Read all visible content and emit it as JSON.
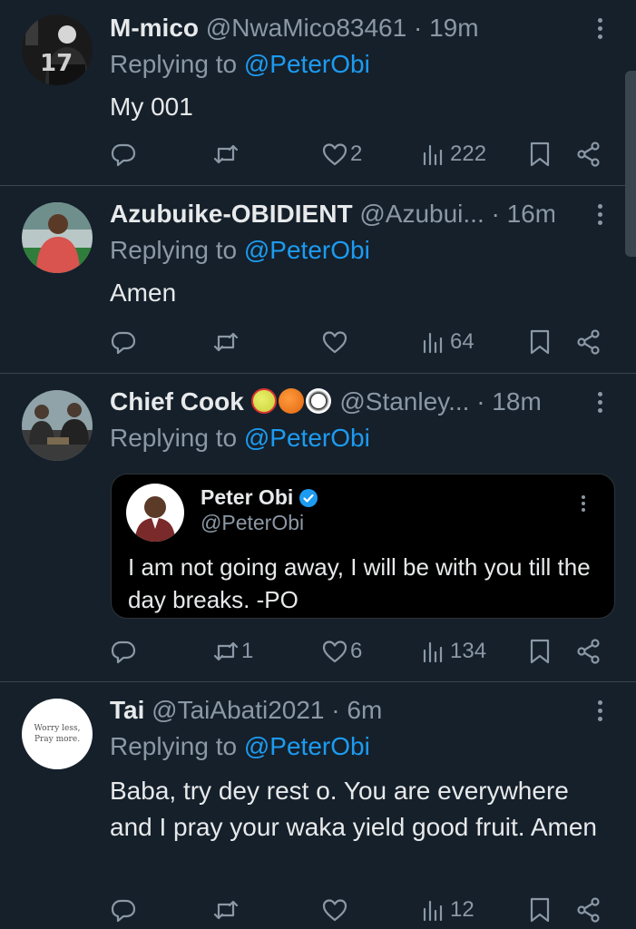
{
  "tweets": [
    {
      "name": "M-mico",
      "handle": "@NwaMico83461",
      "time": "· 19m",
      "replying_prefix": "Replying to ",
      "replying_to": "@PeterObi",
      "text": "My 001",
      "likes": "2",
      "retweets": "",
      "views": "222"
    },
    {
      "name": "Azubuike-OBIDIENT",
      "handle": "@Azubui...",
      "time": "· 16m",
      "replying_prefix": "Replying to ",
      "replying_to": "@PeterObi",
      "text": "Amen",
      "likes": "",
      "retweets": "",
      "views": "64"
    },
    {
      "name": "Chief Cook",
      "name_emojis": [
        "softball",
        "basketball",
        "soccer-ball"
      ],
      "handle": "@Stanley...",
      "time": "· 18m",
      "replying_prefix": "Replying to ",
      "replying_to": "@PeterObi",
      "text": "",
      "likes": "6",
      "retweets": "1",
      "views": "134",
      "quote": {
        "name": "Peter Obi",
        "verified_icon": "verified-badge-icon",
        "handle": "@PeterObi",
        "text": "I am not going away, I will be with you till the day breaks. -PO"
      }
    },
    {
      "name": "Tai",
      "handle": "@TaiAbati2021",
      "time": "· 6m",
      "replying_prefix": "Replying to ",
      "replying_to": "@PeterObi",
      "text": "Baba, try dey rest o. You are everywhere and I pray your waka yield good fruit. Amen",
      "avatar_text": "Worry less, Pray more.",
      "likes": "",
      "retweets": "",
      "views": "12"
    }
  ],
  "colors": {
    "background": "#15202b",
    "text": "#e7e9ea",
    "muted": "#8b98a5",
    "accent": "#1d9bf0",
    "divider": "#38444d"
  }
}
